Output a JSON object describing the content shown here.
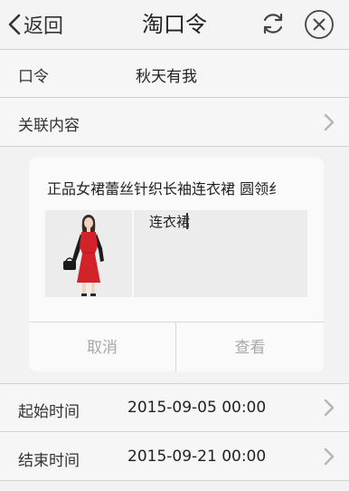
{
  "header": {
    "back_label": "返回",
    "title": "淘口令",
    "refresh_icon": "refresh-icon",
    "close_icon": "close-circle-icon"
  },
  "fields": {
    "token_label": "口令",
    "token_value": "秋天有我",
    "related_label": "关联内容",
    "start_label": "起始时间",
    "start_value": "2015-09-05 00:00",
    "end_label": "结束时间",
    "end_value": "2015-09-21 00:00"
  },
  "card": {
    "product_title": "正品女裙蕾丝针织长袖连衣裙 圆领纟",
    "keyword": "连衣裙",
    "cancel_label": "取消",
    "view_label": "查看"
  },
  "colors": {
    "dress_red": "#d2232a",
    "muted_button_text": "#a8a8a8"
  }
}
